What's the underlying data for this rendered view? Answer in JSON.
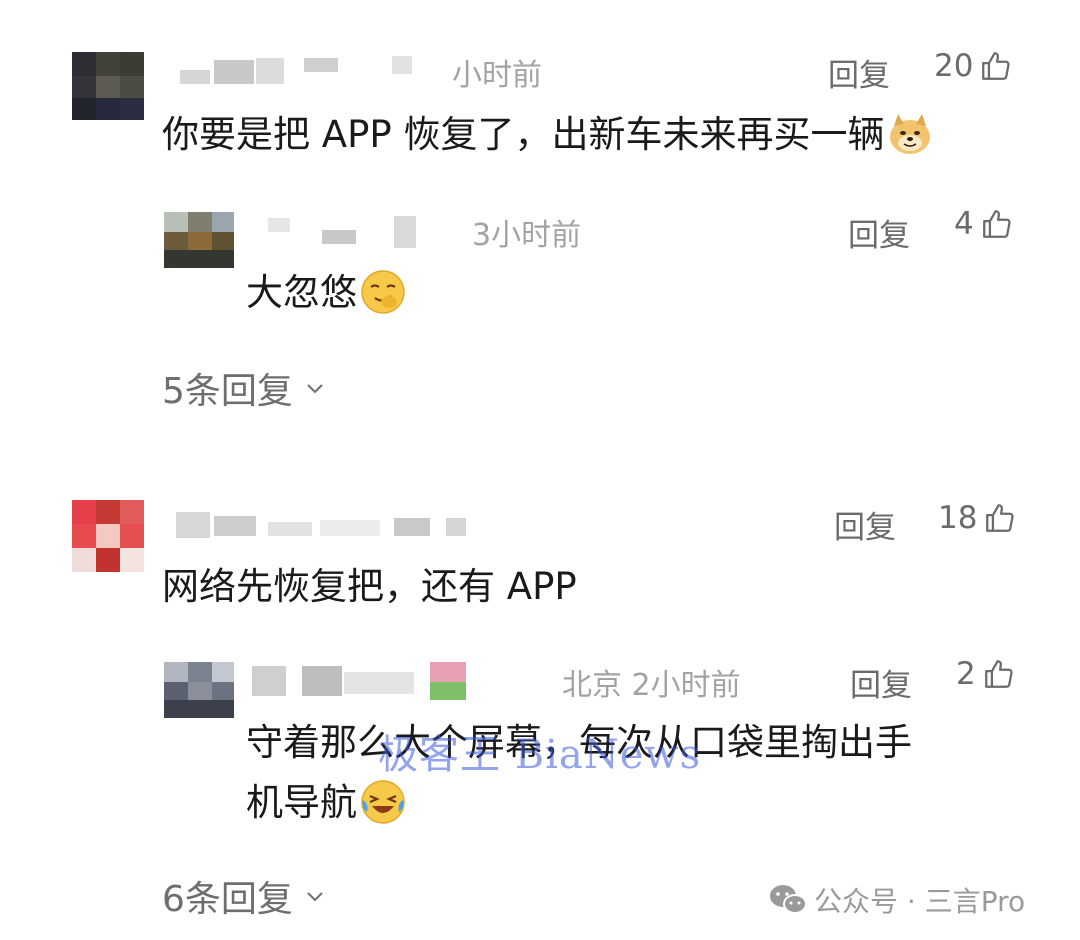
{
  "colors": {
    "text_primary": "#1a1a1a",
    "text_meta": "#a3a3a3",
    "action_gray": "#6b6b6b",
    "watermark_blue": "#5a78e0"
  },
  "comments": [
    {
      "time": "小时前",
      "reply_label": "回复",
      "likes": "20",
      "text": "你要是把 APP 恢复了，出新车未来再买一辆",
      "emoji": "doge-emoji",
      "replies": [
        {
          "time": "3小时前",
          "reply_label": "回复",
          "likes": "4",
          "text": "大忽悠",
          "emoji": "smirk-emoji"
        }
      ],
      "more_replies": "5条回复"
    },
    {
      "time": "",
      "reply_label": "回复",
      "likes": "18",
      "text": "网络先恢复把，还有 APP",
      "replies": [
        {
          "location_time": "北京 2小时前",
          "reply_label": "回复",
          "likes": "2",
          "text_line1": "守着那么大个屏幕，每次从口袋里掏出手",
          "text_line2": "机导航",
          "emoji": "laugh-cry-emoji"
        }
      ],
      "more_replies": "6条回复"
    }
  ],
  "watermark": "极客王 BiaNews",
  "footer": {
    "brand": "公众号 · 三言Pro"
  }
}
